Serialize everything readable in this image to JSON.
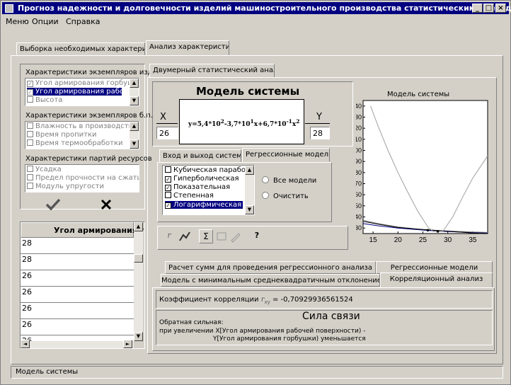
{
  "window": {
    "title": "Прогноз надежности и долговечности изделий машиностроительного производства статистическими методами"
  },
  "menu": [
    "Меню",
    "Опции",
    "Справка"
  ],
  "tabs": {
    "t1": "Выборка необходимых характеристик",
    "t2": "Анализ характеристик"
  },
  "left": {
    "g1_title": "Характеристики экземпляров изд.",
    "g1_items": [
      "Угол армирования горбушк",
      "Угол армирования рабочей",
      "Высота"
    ],
    "g2_title": "Характеристики экземпляров б.п.",
    "g2_items": [
      "Влажность в производстве",
      "Время пропитки",
      "Время термообработки"
    ],
    "g3_title": "Характеристики  партий ресурсов",
    "g3_items": [
      "Усадка",
      "Предел прочности на сжатие",
      "Модуль упругости"
    ],
    "ok_icon": "checkmark-icon",
    "cancel_icon": "cross-icon",
    "grid_header": "Угол армирования г",
    "grid_values": [
      "28",
      "28",
      "26",
      "26",
      "26",
      "26",
      "26"
    ]
  },
  "inner_tab": "Двумерный статистический анализ",
  "model": {
    "title": "Модель системы",
    "x_label": "X",
    "y_label": "Y",
    "x_value": "26",
    "y_value": "28",
    "formula": {
      "a": "y=5,4",
      "e1": "2",
      "b": "-3,7",
      "e2": "1",
      "c": "x+6,7",
      "e3": "-1",
      "d": "x",
      "e4": "2",
      "ten": "*10"
    }
  },
  "subtabs": [
    "Вход и выход системы",
    "Регрессионные модели"
  ],
  "models": [
    {
      "label": "Кубическая парабола",
      "checked": false
    },
    {
      "label": "Гиперболическая",
      "checked": true
    },
    {
      "label": "Показательная",
      "checked": true
    },
    {
      "label": "Степенная",
      "checked": false
    },
    {
      "label": "Логарифмическая",
      "checked": true
    }
  ],
  "radio": {
    "all": "Все модели",
    "clear": "Очистить"
  },
  "toolbar_glyphs": [
    "r",
    "Σ",
    "?"
  ],
  "chart_data": {
    "type": "line",
    "title": "Модель системы",
    "xlim": [
      13,
      38
    ],
    "ylim": [
      25,
      145
    ],
    "xticks": [
      15,
      20,
      25,
      30,
      35
    ],
    "yticks": [
      30,
      40,
      50,
      60,
      70,
      80,
      90,
      100,
      110,
      120,
      130,
      140
    ],
    "grid": false,
    "series": [
      {
        "x": [
          13,
          16,
          20,
          24,
          27,
          29,
          32,
          35,
          38
        ],
        "y": [
          34,
          32,
          30,
          28.5,
          27.5,
          27,
          26.5,
          26,
          25.5
        ],
        "color": "#000080"
      },
      {
        "x": [
          13,
          16,
          20,
          24,
          27,
          29,
          32,
          35,
          38
        ],
        "y": [
          37,
          34,
          31,
          29,
          28,
          27.5,
          27,
          26.5,
          26
        ],
        "color": "#808080"
      },
      {
        "x": [
          13,
          16,
          20,
          24,
          27,
          29,
          32,
          35,
          38
        ],
        "y": [
          36,
          33.5,
          30.5,
          29,
          28,
          27.5,
          26.5,
          25.5,
          25
        ],
        "color": "#000000"
      },
      {
        "x": [
          14.5,
          16,
          18,
          20,
          22,
          24,
          26,
          27,
          29,
          31,
          33,
          35,
          38
        ],
        "y": [
          140,
          122,
          100,
          80,
          62,
          45,
          31,
          27,
          27,
          40,
          58,
          75,
          95
        ],
        "color": "#a0a0a0"
      }
    ],
    "points": [
      {
        "x": 26,
        "y": 28
      },
      {
        "x": 28,
        "y": 27
      }
    ]
  },
  "bottom_tabs": {
    "r1a": "Расчет сумм для проведения регрессионного анализа",
    "r1b": "Регрессионные модели",
    "r2a": "Модель с минимальным среднеквадратичным отклонением",
    "r2b": "Корреляционный анализ"
  },
  "corr": {
    "label": "Коэффициент корреляции",
    "symbol": "r",
    "sub": "xy",
    "value": "= -0,70929936561524",
    "strength_title": "Сила связи",
    "line1": "Обратная сильная:",
    "line2": "при увеличении X[Угол армирования рабочей поверхности) -",
    "line3": "Y[Угол армирования горбушки) уменьшается"
  },
  "status": "Модель системы"
}
